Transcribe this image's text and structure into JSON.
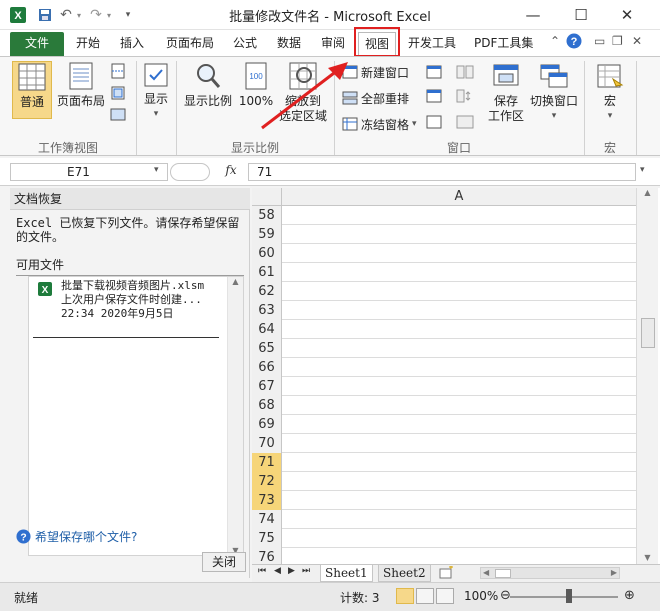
{
  "title": "批量修改文件名 - Microsoft Excel",
  "quick_access": {
    "undo_glyph": "↶",
    "redo_glyph": "↷"
  },
  "window": {
    "minimize": "—",
    "maximize": "☐",
    "close": "✕"
  },
  "tabs": [
    "文件",
    "开始",
    "插入",
    "页面布局",
    "公式",
    "数据",
    "审阅",
    "视图",
    "开发工具",
    "PDF工具集"
  ],
  "active_tab": "视图",
  "ribbon": {
    "workbook_views": {
      "label": "工作簿视图",
      "normal": "普通",
      "page_layout": "页面布局"
    },
    "show": {
      "label": "显示"
    },
    "zoom": {
      "label": "显示比例",
      "zoom": "显示比例",
      "hundred": "100%",
      "to_selection_line1": "缩放到",
      "to_selection_line2": "选定区域"
    },
    "window": {
      "label": "窗口",
      "new_window": "新建窗口",
      "arrange_all": "全部重排",
      "freeze_panes": "冻结窗格",
      "save_workspace_line1": "保存",
      "save_workspace_line2": "工作区",
      "switch_windows": "切换窗口"
    },
    "macros": {
      "label": "宏",
      "macros": "宏"
    }
  },
  "formula_bar": {
    "name_box": "E71",
    "fx": "fx",
    "value": "71"
  },
  "recovery_pane": {
    "title": "文档恢复",
    "description": "Excel 已恢复下列文件。请保存希望保留的文件。",
    "available_files": "可用文件",
    "file": {
      "name": "批量下载视频音频图片.xlsm",
      "desc": "上次用户保存文件时创建...",
      "time": "22:34 2020年9月5日"
    },
    "help_link": "希望保存哪个文件?",
    "close_button": "关闭"
  },
  "sheet": {
    "column_header": "A",
    "rows": [
      "58",
      "59",
      "60",
      "61",
      "62",
      "63",
      "64",
      "65",
      "66",
      "67",
      "68",
      "69",
      "70",
      "71",
      "72",
      "73",
      "74",
      "75",
      "76"
    ],
    "selected_rows": [
      "71",
      "72",
      "73"
    ],
    "tabs": [
      "Sheet1",
      "Sheet2"
    ]
  },
  "status_bar": {
    "ready": "就绪",
    "count": "计数: 3",
    "zoom": "100%"
  },
  "colors": {
    "file_tab": "#2a7a3a",
    "highlight_box": "#e02020",
    "selected_row_header": "#f6d579",
    "normal_button": "#f6d88a"
  }
}
